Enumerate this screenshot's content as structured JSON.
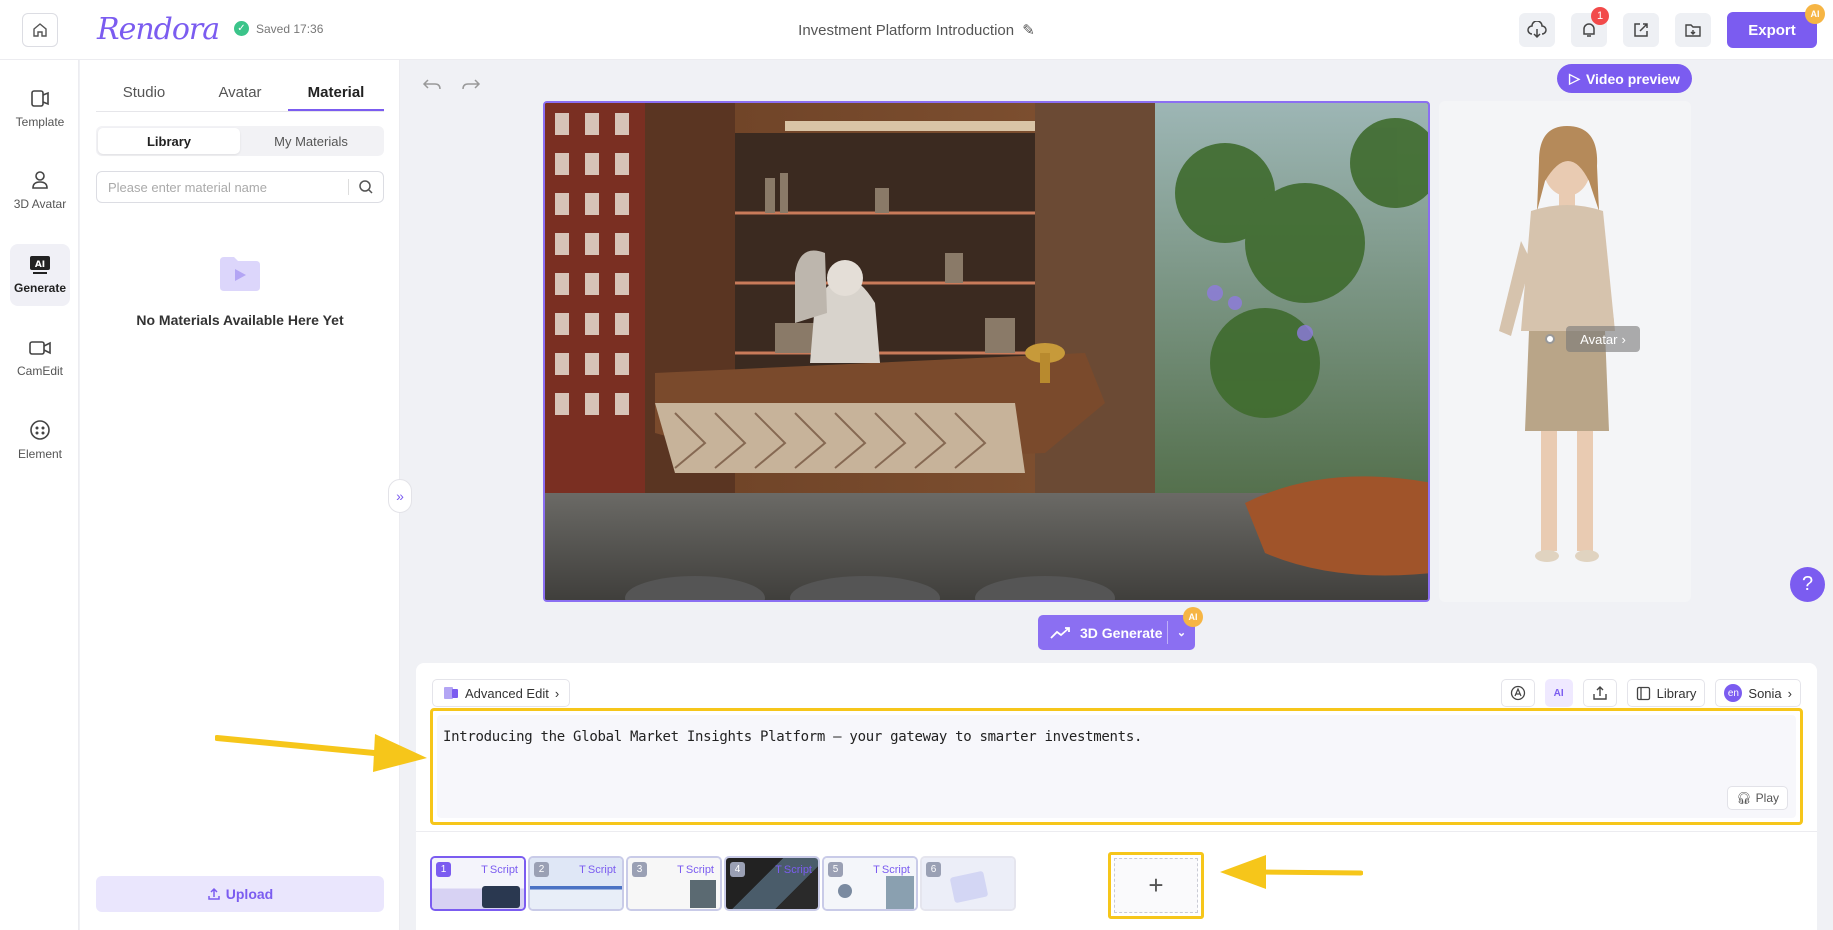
{
  "header": {
    "logo": "Rendora",
    "saved_text": "Saved 17:36",
    "project_title": "Investment Platform Introduction",
    "notification_count": "1",
    "export_label": "Export",
    "ai_badge": "AI"
  },
  "sidenav": {
    "items": [
      {
        "label": "Template",
        "icon": "template-icon"
      },
      {
        "label": "3D Avatar",
        "icon": "avatar-icon"
      },
      {
        "label": "Generate",
        "icon": "ai-generate-icon",
        "active": true
      },
      {
        "label": "CamEdit",
        "icon": "camera-icon"
      },
      {
        "label": "Element",
        "icon": "element-icon"
      }
    ]
  },
  "panel": {
    "tabs": [
      "Studio",
      "Avatar",
      "Material"
    ],
    "active_tab": "Material",
    "segments": [
      "Library",
      "My Materials"
    ],
    "active_segment": "Library",
    "search_placeholder": "Please enter material name",
    "empty_text": "No Materials Available Here Yet",
    "upload_label": "Upload"
  },
  "preview": {
    "video_preview_label": "Video preview",
    "avatar_tag": "Avatar",
    "generate_label": "3D Generate",
    "generate_badge": "AI"
  },
  "editor": {
    "advanced_edit_label": "Advanced Edit",
    "ai_tool_label": "AI",
    "library_label": "Library",
    "voice_lang": "en",
    "voice_name": "Sonia",
    "script_text": "Introducing the Global Market Insights Platform – your gateway to smarter investments.",
    "play_label": "Play",
    "slides": [
      {
        "num": "1",
        "label": "Script",
        "active": true
      },
      {
        "num": "2",
        "label": "Script"
      },
      {
        "num": "3",
        "label": "Script"
      },
      {
        "num": "4",
        "label": "Script"
      },
      {
        "num": "5",
        "label": "Script"
      },
      {
        "num": "6",
        "label": ""
      }
    ],
    "add_slide_label": "+"
  },
  "colors": {
    "accent": "#7b5cf0",
    "highlight": "#f6c61a",
    "saved_green": "#3bc48a",
    "badge_red": "#f24a4a"
  }
}
